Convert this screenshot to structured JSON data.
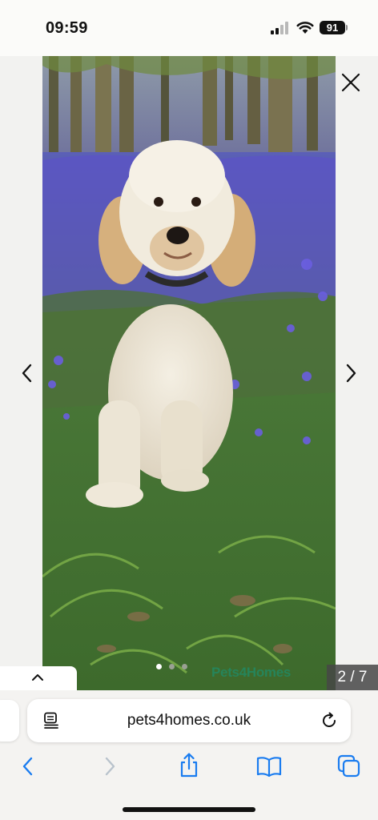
{
  "status_bar": {
    "time": "09:59",
    "battery": "91"
  },
  "gallery": {
    "counter": "2 / 7",
    "watermark": "Pets4Homes",
    "current_index": 2,
    "total": 7
  },
  "browser": {
    "url": "pets4homes.co.uk"
  },
  "icons": {
    "close": "close-icon",
    "prev": "chevron-left-icon",
    "next": "chevron-right-icon",
    "collapse": "chevron-up-icon",
    "reader": "reader-icon",
    "reload": "reload-icon",
    "back": "back-icon",
    "forward": "forward-icon",
    "share": "share-icon",
    "bookmarks": "bookmarks-icon",
    "tabs": "tabs-icon"
  },
  "colors": {
    "accent": "#1a7cf0",
    "disabled": "#b9c3cc",
    "watermark": "#1e8d6a"
  }
}
